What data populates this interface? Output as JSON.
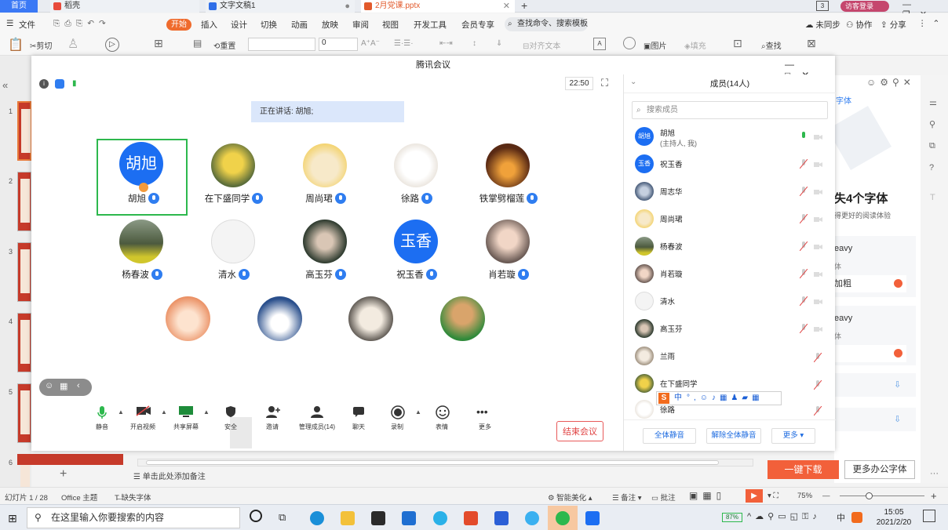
{
  "tabs": [
    {
      "label": "首页"
    },
    {
      "label": "稻壳"
    },
    {
      "label": "文字文稿1"
    },
    {
      "label": "2月党课.pptx"
    }
  ],
  "topright": {
    "login": "访客登录"
  },
  "menu": {
    "file": "文件",
    "start": "开始",
    "items": [
      "插入",
      "设计",
      "切换",
      "动画",
      "放映",
      "审阅",
      "视图",
      "开发工具",
      "会员专享"
    ],
    "search": "查找命令、搜索模板",
    "sync": "未同步",
    "collab": "协作",
    "share": "分享"
  },
  "toolbar": {
    "paste": "粘贴",
    "cut": "剪切",
    "reset": "重置",
    "fontsize": "0",
    "align_text": "对齐文本",
    "picture": "图片",
    "fill": "填充",
    "find": "查找"
  },
  "meeting": {
    "title": "腾讯会议",
    "time": "22:50",
    "speaking": "正在讲话: 胡旭;",
    "participants": [
      {
        "name": "胡旭",
        "avatar_text": "胡旭"
      },
      {
        "name": "在下盛同学"
      },
      {
        "name": "周尚珺"
      },
      {
        "name": "徐路"
      },
      {
        "name": "铁掌劈榴莲"
      },
      {
        "name": "杨春波"
      },
      {
        "name": "清水"
      },
      {
        "name": "高玉芬"
      },
      {
        "name": "祝玉香",
        "avatar_text": "玉香"
      },
      {
        "name": "肖若璇"
      }
    ],
    "bottom": [
      "静音",
      "开启视频",
      "共享屏幕",
      "安全",
      "邀请",
      "管理成员(14)",
      "聊天",
      "录制",
      "表情",
      "更多"
    ],
    "end": "结束会议"
  },
  "members": {
    "header": "成员(14人)",
    "search_placeholder": "搜索成员",
    "list": [
      {
        "name": "胡旭",
        "sub": "(主持人, 我)",
        "avatar_text": "胡旭"
      },
      {
        "name": "祝玉香",
        "avatar_text": "玉香"
      },
      {
        "name": "周志华"
      },
      {
        "name": "周尚珺"
      },
      {
        "name": "杨春波"
      },
      {
        "name": "肖若璇"
      },
      {
        "name": "清水"
      },
      {
        "name": "高玉芬"
      },
      {
        "name": "兰雨"
      },
      {
        "name": "在下盛同学"
      },
      {
        "name": "徐路"
      }
    ],
    "mute_all": "全体静音",
    "unmute_all": "解除全体静音",
    "more": "更多"
  },
  "font_panel": {
    "link": "字体",
    "headline": "失4个字体",
    "subline": "得更好的阅读体验",
    "item1": "eavy",
    "item1_sub": "体",
    "item1_bold": "加粗",
    "item2": "eavy",
    "item2_sub": "体",
    "download": "一键下载",
    "more_fonts": "更多办公字体"
  },
  "notes": "单击此处添加备注",
  "status": {
    "slide": "幻灯片 1 / 28",
    "theme": "Office 主题",
    "missing_font": "缺失字体",
    "beautify": "智能美化",
    "notes": "备注",
    "comment": "批注",
    "zoom": "75%"
  },
  "slides": [
    "1",
    "2",
    "3",
    "4",
    "5",
    "6"
  ],
  "taskbar": {
    "search": "在这里输入你要搜索的内容",
    "battery": "87%",
    "ime": "中",
    "time": "15:05",
    "date": "2021/2/20"
  },
  "ime_bar": {
    "label": "中"
  }
}
